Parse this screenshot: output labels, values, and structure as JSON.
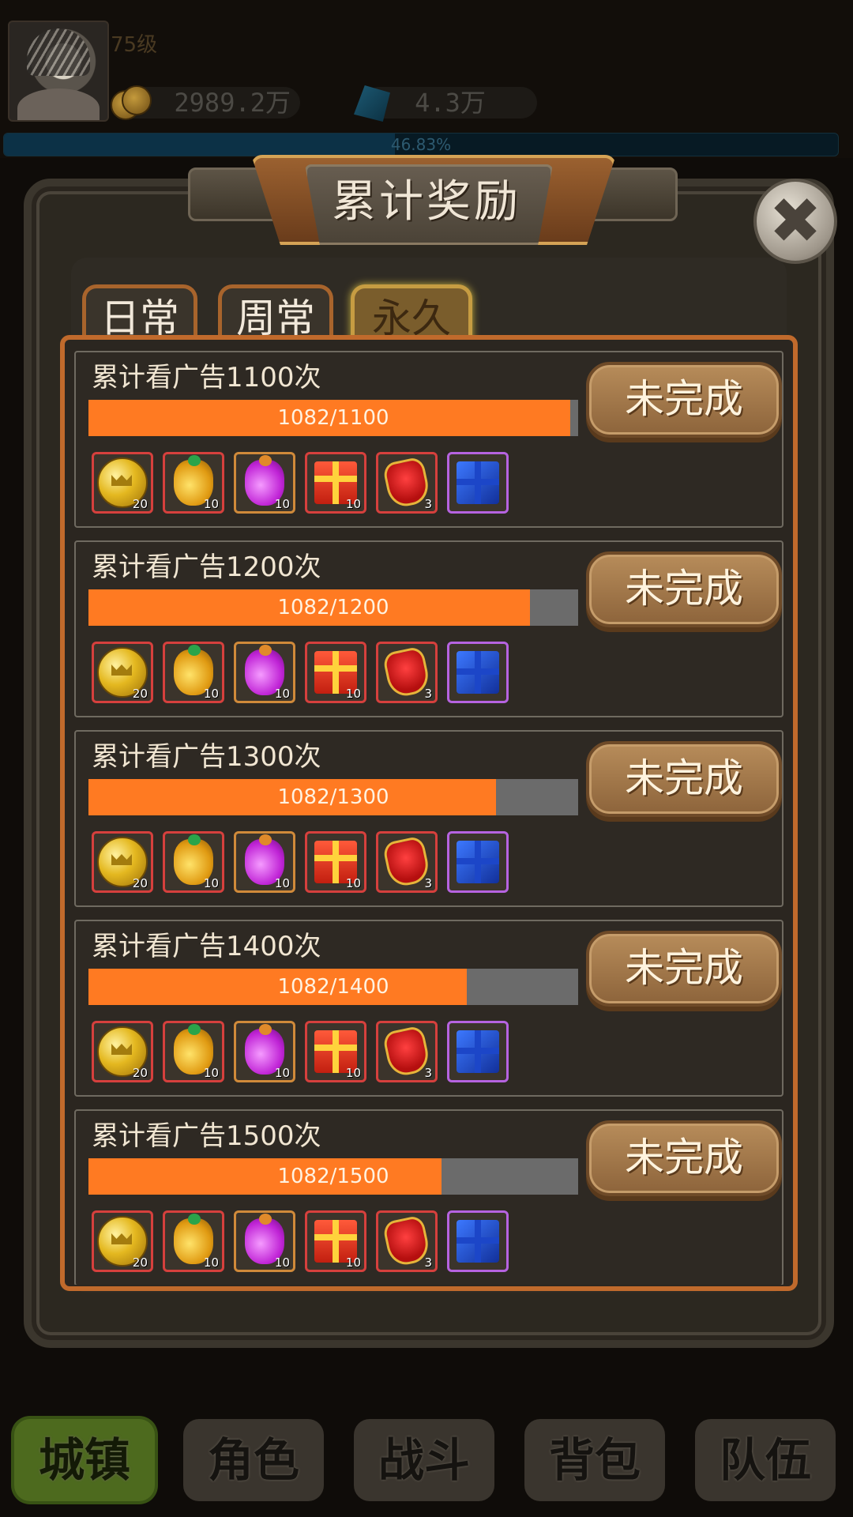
{
  "hud": {
    "level": "75级",
    "gold": "2989.2万",
    "gems": "4.3万",
    "xp_text": "46.83%",
    "xp_fraction": 0.4683
  },
  "dialog": {
    "title": "累计奖励",
    "close_icon": "close-icon",
    "tabs": [
      {
        "label": "日常",
        "selected": false
      },
      {
        "label": "周常",
        "selected": false
      },
      {
        "label": "永久",
        "selected": true
      }
    ]
  },
  "tasks": [
    {
      "title": "累计看广告1100次",
      "progress_text": "1082/1100",
      "current": 1082,
      "target": 1100,
      "status": "未完成"
    },
    {
      "title": "累计看广告1200次",
      "progress_text": "1082/1200",
      "current": 1082,
      "target": 1200,
      "status": "未完成"
    },
    {
      "title": "累计看广告1300次",
      "progress_text": "1082/1300",
      "current": 1082,
      "target": 1300,
      "status": "未完成"
    },
    {
      "title": "累计看广告1400次",
      "progress_text": "1082/1400",
      "current": 1082,
      "target": 1400,
      "status": "未完成"
    },
    {
      "title": "累计看广告1500次",
      "progress_text": "1082/1500",
      "current": 1082,
      "target": 1500,
      "status": "未完成"
    }
  ],
  "rewards": [
    {
      "icon": "gold-coin-icon",
      "qty": "20",
      "rarity": "red"
    },
    {
      "icon": "yellow-potion-icon",
      "qty": "10",
      "rarity": "red"
    },
    {
      "icon": "purple-potion-icon",
      "qty": "10",
      "rarity": "orange"
    },
    {
      "icon": "red-gift-box-icon",
      "qty": "10",
      "rarity": "red"
    },
    {
      "icon": "red-pouch-icon",
      "qty": "3",
      "rarity": "red"
    },
    {
      "icon": "blue-gift-box-icon",
      "qty": "",
      "rarity": "purple"
    }
  ],
  "nav": [
    {
      "label": "城镇",
      "active": true
    },
    {
      "label": "角色",
      "active": false
    },
    {
      "label": "战斗",
      "active": false
    },
    {
      "label": "背包",
      "active": false
    },
    {
      "label": "队伍",
      "active": false
    }
  ]
}
